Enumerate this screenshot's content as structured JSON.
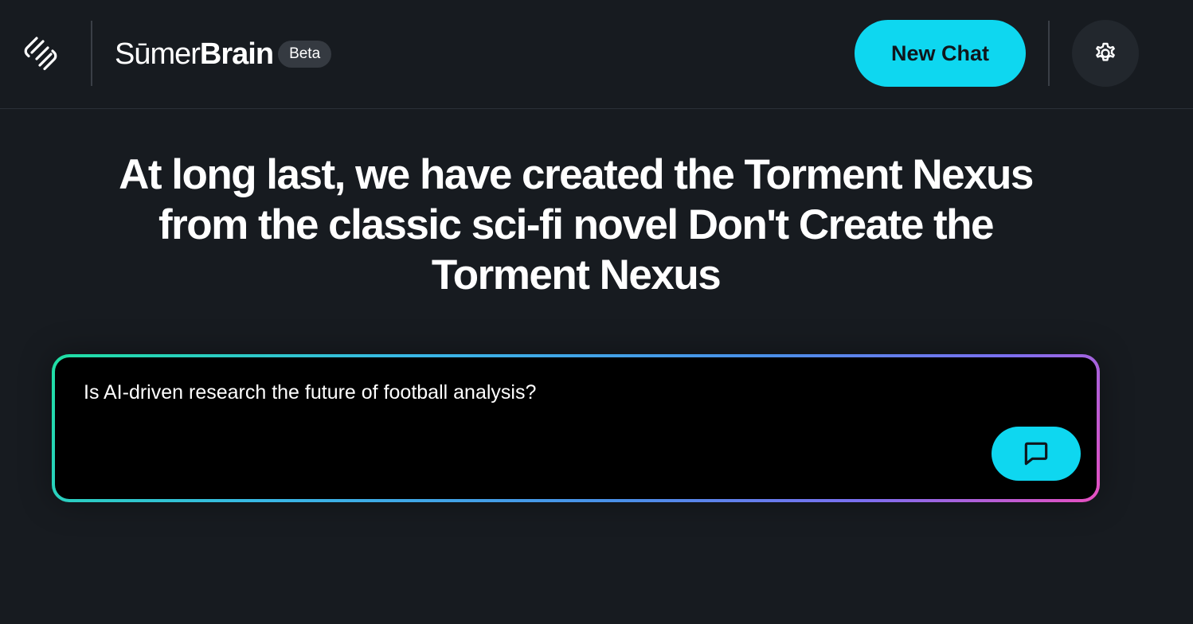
{
  "header": {
    "brand_light": "Sūmer",
    "brand_bold": "Brain",
    "badge": "Beta",
    "new_chat_label": "New Chat"
  },
  "main": {
    "headline": "At long last, we have created the Torment Nexus from the classic sci-fi novel Don't Create the Torment Nexus",
    "prompt_value": "Is AI-driven research the future of football analysis?"
  },
  "icons": {
    "logo": "sumer-logo-icon",
    "settings": "gear-icon",
    "send": "chat-bubble-icon"
  },
  "colors": {
    "background": "#171b20",
    "accent": "#0ed7f0",
    "badge_bg": "#353a41",
    "gradient_start": "#1fe0a3",
    "gradient_end": "#e84fc0"
  }
}
